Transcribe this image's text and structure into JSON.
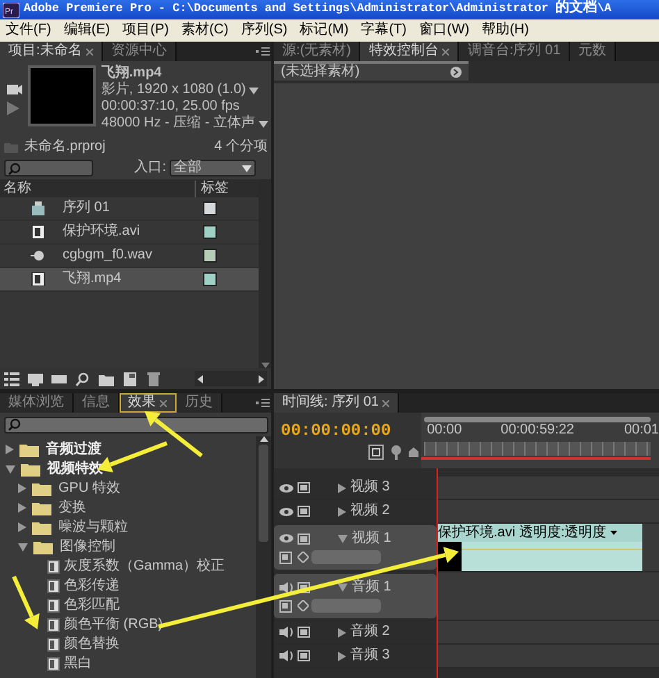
{
  "window": {
    "icon_text": "Pr",
    "title": "Adobe Premiere Pro - C:\\Documents and Settings\\Administrator\\Administrator 的文档\\A"
  },
  "menu": [
    "文件(F)",
    "编辑(E)",
    "项目(P)",
    "素材(C)",
    "序列(S)",
    "标记(M)",
    "字幕(T)",
    "窗口(W)",
    "帮助(H)"
  ],
  "project_panel": {
    "tabs": [
      {
        "label": "项目:未命名",
        "selected": true,
        "closable": true
      },
      {
        "label": "资源中心",
        "selected": false,
        "closable": false
      }
    ],
    "clip_info": {
      "name": "飞翔.mp4",
      "lines": [
        {
          "text": "影片, 1920 x 1080 (1.0)",
          "dropdown": true
        },
        {
          "text": "00:00:37:10, 25.00 fps",
          "dropdown": false
        },
        {
          "text": "48000 Hz - 压缩 - 立体声",
          "dropdown": true
        }
      ]
    },
    "project_file": "未命名.prproj",
    "item_count": "4 个分项",
    "entry_label": "入口:",
    "entry_value": "全部",
    "columns": [
      "名称",
      "标签"
    ],
    "items": [
      {
        "name": "序列 01",
        "kind": "sequence",
        "color": "#d4d8da",
        "selected": false
      },
      {
        "name": "保护环境.avi",
        "kind": "video",
        "color": "#9fd0c6",
        "selected": false
      },
      {
        "name": "cgbgm_f0.wav",
        "kind": "audio",
        "color": "#b5cdb6",
        "selected": false
      },
      {
        "name": "飞翔.mp4",
        "kind": "video",
        "color": "#9fd0c6",
        "selected": true
      }
    ]
  },
  "effect_controls_panel": {
    "tabs": [
      {
        "label": "源:(无素材)",
        "selected": false,
        "closable": false
      },
      {
        "label": "特效控制台",
        "selected": true,
        "closable": true
      },
      {
        "label": "调音台:序列 01",
        "selected": false,
        "closable": false
      },
      {
        "label": "元数",
        "selected": false,
        "closable": false
      }
    ],
    "message": "(未选择素材)"
  },
  "effects_panel": {
    "tabs": [
      {
        "label": "媒体浏览",
        "selected": false,
        "closable": false
      },
      {
        "label": "信息",
        "selected": false,
        "closable": false
      },
      {
        "label": "效果",
        "selected": true,
        "closable": true
      },
      {
        "label": "历史",
        "selected": false,
        "closable": false
      }
    ],
    "tree": [
      {
        "label": "音频过渡",
        "kind": "folder",
        "bold": true,
        "expanded": false
      },
      {
        "label": "视频特效",
        "kind": "folder",
        "bold": true,
        "expanded": true,
        "children": [
          {
            "label": "GPU 特效",
            "kind": "folder",
            "bold": false,
            "expanded": false
          },
          {
            "label": "变换",
            "kind": "folder",
            "bold": false,
            "expanded": false
          },
          {
            "label": "噪波与颗粒",
            "kind": "folder",
            "bold": false,
            "expanded": false
          },
          {
            "label": "图像控制",
            "kind": "folder",
            "bold": false,
            "expanded": true,
            "children": [
              {
                "label": "灰度系数（Gamma）校正",
                "kind": "effect"
              },
              {
                "label": "色彩传递",
                "kind": "effect"
              },
              {
                "label": "色彩匹配",
                "kind": "effect"
              },
              {
                "label": "颜色平衡 (RGB)",
                "kind": "effect"
              },
              {
                "label": "颜色替换",
                "kind": "effect"
              },
              {
                "label": "黑白",
                "kind": "effect"
              }
            ]
          }
        ]
      }
    ]
  },
  "timeline_panel": {
    "tab": {
      "label": "时间线: 序列 01",
      "selected": true,
      "closable": true
    },
    "timecode": "00:00:00:00",
    "ruler_labels": [
      "00:00",
      "00:00:59:22",
      "00:01"
    ],
    "tracks": [
      {
        "name": "视频 3",
        "kind": "video",
        "expanded": false
      },
      {
        "name": "视频 2",
        "kind": "video",
        "expanded": false
      },
      {
        "name": "视频 1",
        "kind": "video",
        "expanded": true,
        "clip": {
          "name": "保护环境.avi 透明度:透明度"
        }
      },
      {
        "name": "音频 1",
        "kind": "audio",
        "expanded": true
      },
      {
        "name": "音频 2",
        "kind": "audio",
        "expanded": false
      },
      {
        "name": "音频 3",
        "kind": "audio",
        "expanded": false
      }
    ]
  }
}
